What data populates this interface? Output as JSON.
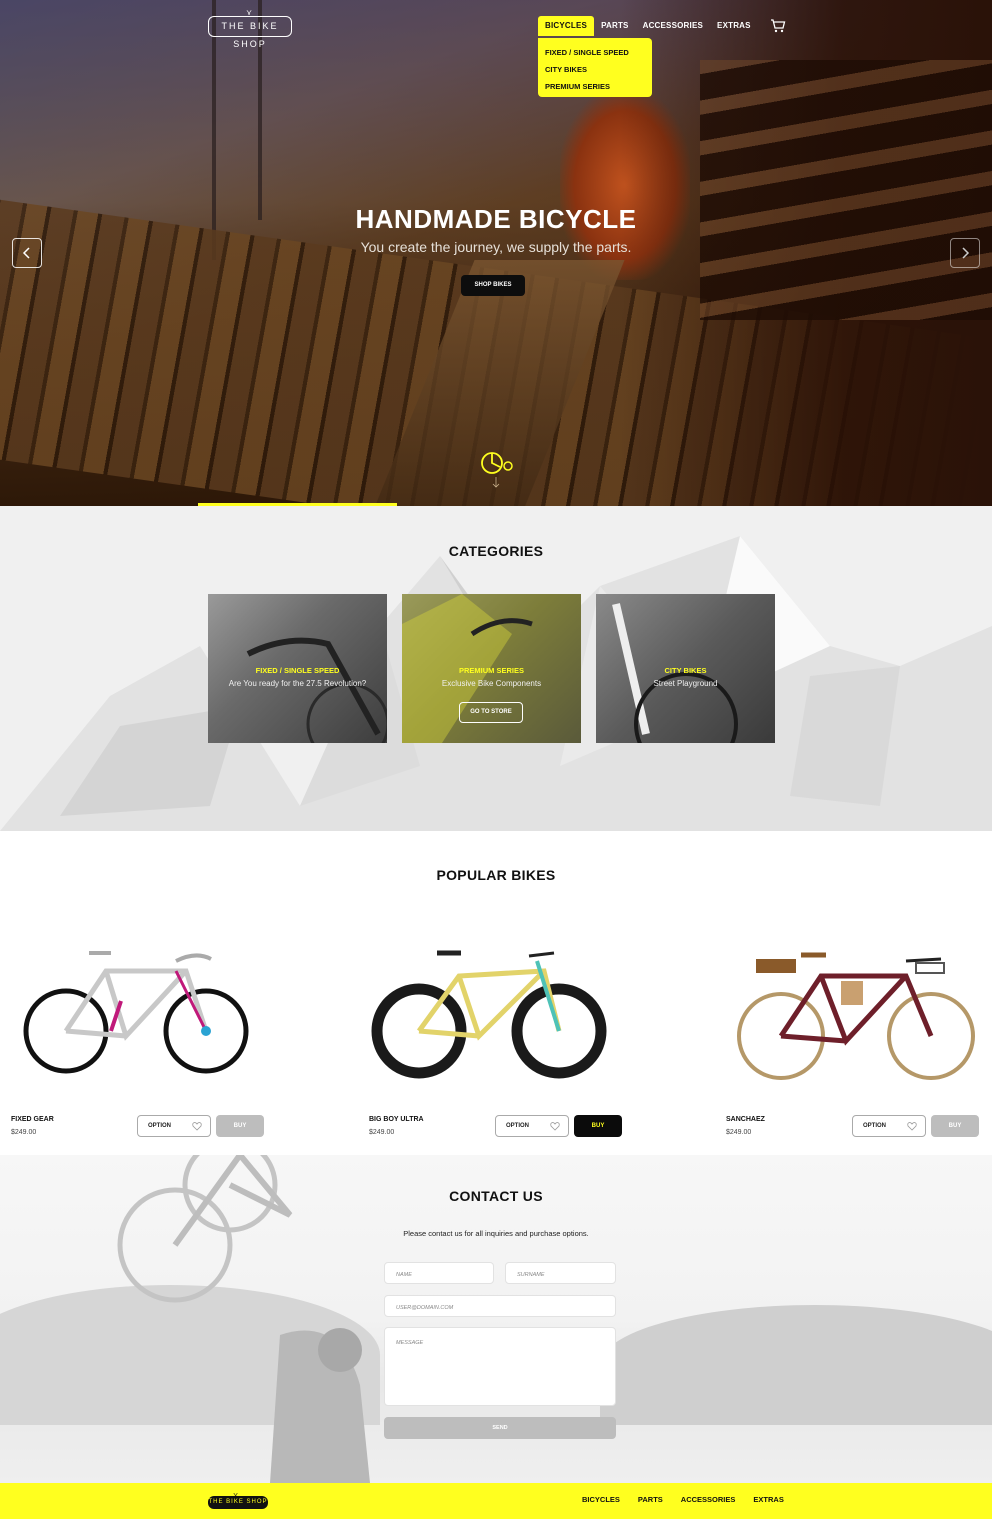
{
  "header": {
    "logo_text": "THE BIKE SHOP",
    "nav": [
      {
        "label": "BICYCLES"
      },
      {
        "label": "PARTS"
      },
      {
        "label": "ACCESSORIES"
      },
      {
        "label": "EXTRAS"
      }
    ],
    "cart_icon": "cart-icon",
    "dropdown": [
      {
        "label": "FIXED / SINGLE SPEED"
      },
      {
        "label": "CITY BIKES"
      },
      {
        "label": "PREMIUM SERIES"
      }
    ]
  },
  "hero": {
    "title": "HANDMADE BICYCLE",
    "subtitle": "You create the journey, we supply the parts.",
    "button": "SHOP BIKES"
  },
  "categories": {
    "title": "CATEGORIES",
    "items": [
      {
        "name": "FIXED / SINGLE SPEED",
        "desc": "Are You ready for the 27.5 Revolution?"
      },
      {
        "name": "PREMIUM SERIES",
        "desc": "Exclusive  Bike Components",
        "button": "GO TO STORE"
      },
      {
        "name": "CITY BIKES",
        "desc": "Street Playground"
      }
    ]
  },
  "popular": {
    "title": "POPULAR BIKES",
    "products": [
      {
        "name": "FIXED GEAR",
        "price": "$249.00",
        "option": "OPTION",
        "buy": "BUY"
      },
      {
        "name": "BIG BOY ULTRA",
        "price": "$249.00",
        "option": "OPTION",
        "buy": "BUY"
      },
      {
        "name": "SANCHAEZ",
        "price": "$249.00",
        "option": "OPTION",
        "buy": "BUY"
      }
    ]
  },
  "contact": {
    "title": "CONTACT US",
    "subtitle": "Please contact us for all inquiries and purchase options.",
    "name_placeholder": "NAME",
    "surname_placeholder": "SURNAME",
    "email_placeholder": "USER@DOMAIN.COM",
    "message_placeholder": "MESSAGE",
    "send": "SEND"
  },
  "footer": {
    "logo_text": "THE BIKE SHOP",
    "nav": [
      {
        "label": "BICYCLES"
      },
      {
        "label": "PARTS"
      },
      {
        "label": "ACCESSORIES"
      },
      {
        "label": "EXTRAS"
      }
    ]
  },
  "colors": {
    "accent": "#ffff1f",
    "dark": "#0d0d0d",
    "grey_button": "#bdbdbd"
  }
}
